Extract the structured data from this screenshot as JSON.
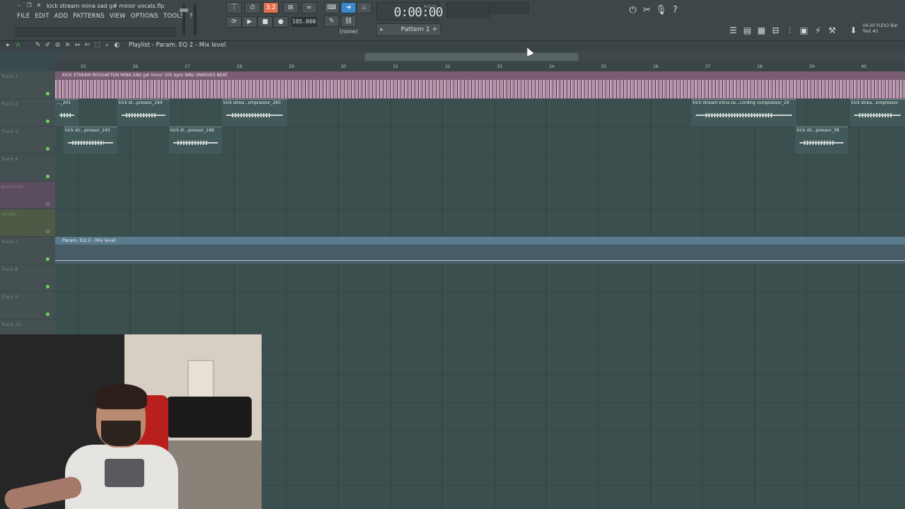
{
  "window": {
    "title": "kick stream mina sad g# minor vocals.flp"
  },
  "menu": [
    "FILE",
    "EDIT",
    "ADD",
    "PATTERNS",
    "VIEW",
    "OPTIONS",
    "TOOLS",
    "?"
  ],
  "transport": {
    "tempo": "105.000",
    "time": "0:00:00",
    "time_unit": "M:S:CS",
    "snap": "(none)",
    "pattern": "Pattern 1",
    "mode_label": "3.2"
  },
  "plugin": {
    "line1": "04-20  FLEX2 Bar",
    "line2": "Test #1"
  },
  "playlist": {
    "title": "Playlist - Param. EQ 2 - Mix level",
    "ruler": [
      "25",
      "26",
      "27",
      "28",
      "29",
      "30",
      "31",
      "32",
      "33",
      "34",
      "35",
      "36",
      "37",
      "38",
      "39",
      "40"
    ],
    "tracks": [
      {
        "name": "Track 1",
        "style": "normal"
      },
      {
        "name": "Track 2",
        "style": "normal"
      },
      {
        "name": "Track 3",
        "style": "normal"
      },
      {
        "name": "Track 4",
        "style": "normal"
      },
      {
        "name": "punch ins",
        "style": "purple"
      },
      {
        "name": "ad libs",
        "style": "olive"
      },
      {
        "name": "Track 7",
        "style": "normal"
      },
      {
        "name": "Track 8",
        "style": "normal"
      },
      {
        "name": "Track 9",
        "style": "normal"
      },
      {
        "name": "Track 10",
        "style": "normal"
      }
    ],
    "beat_clip": "KICK STREAM REGGAETON MINA SAD g# minor 105 bpm WAV UNMIXED BEAT",
    "track2_clips": [
      "..._241",
      "kick st...pressor_244",
      "kick strea...ompressor_260",
      "kick stream mina sa...cording compressor_20",
      "kick strea...ompressor"
    ],
    "track3_clips": [
      "kick str...pressor_243",
      "kick st...pressor_248",
      "kick str...pressor_38"
    ],
    "automation_clip": "Param. EQ 2 - Mix level"
  }
}
